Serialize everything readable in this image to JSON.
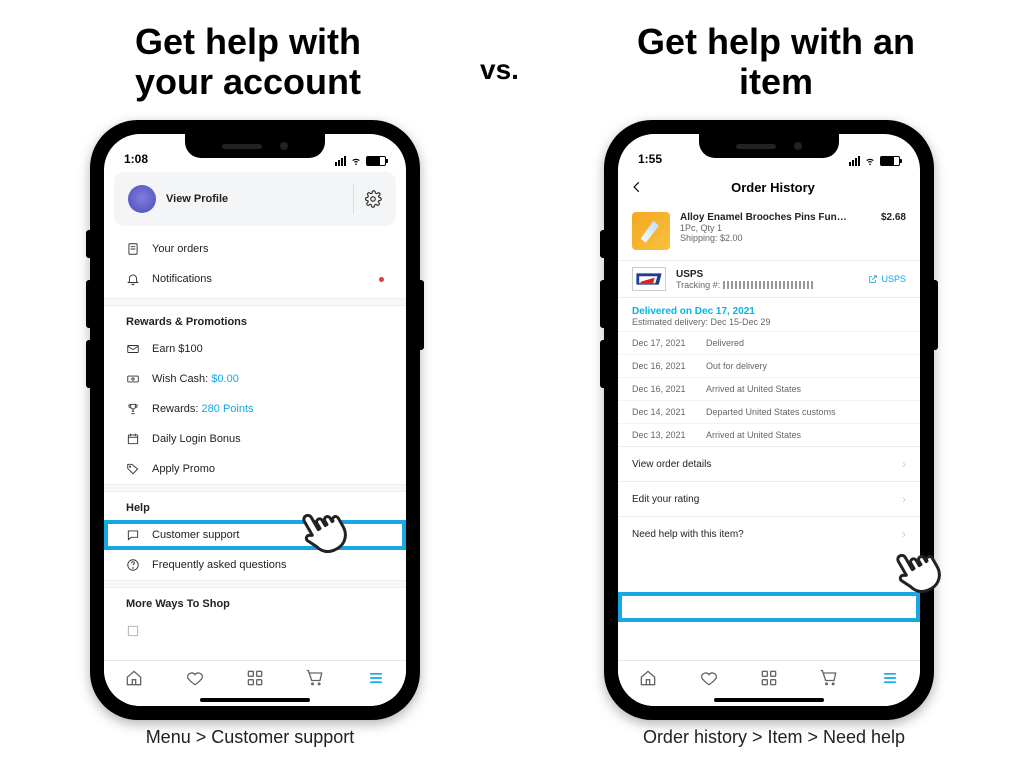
{
  "headings": {
    "left": "Get help with your account",
    "right": "Get help with an item",
    "vs": "vs."
  },
  "captions": {
    "left": "Menu > Customer support",
    "right": "Order history > Item > Need help"
  },
  "phone1": {
    "status_time": "1:08",
    "profile": {
      "view_profile": "View Profile"
    },
    "menu": {
      "your_orders": "Your orders",
      "notifications": "Notifications"
    },
    "rewards_header": "Rewards & Promotions",
    "rewards": {
      "earn": "Earn $100",
      "wish_cash_label": "Wish Cash: ",
      "wish_cash_value": "$0.00",
      "rewards_label": "Rewards: ",
      "rewards_value": "280 Points",
      "daily_login": "Daily Login Bonus",
      "apply_promo": "Apply Promo"
    },
    "help_header": "Help",
    "help": {
      "customer_support": "Customer support",
      "faq": "Frequently asked questions"
    },
    "more_header": "More Ways To Shop"
  },
  "phone2": {
    "status_time": "1:55",
    "nav_title": "Order History",
    "item": {
      "title": "Alloy Enamel Brooches Pins Fun…",
      "price": "$2.68",
      "qty": "1Pc, Qty 1",
      "shipping": "Shipping: $2.00"
    },
    "carrier": {
      "name": "USPS",
      "tracking_label": "Tracking #: ",
      "tracking_link": "USPS"
    },
    "delivery": {
      "title": "Delivered on Dec 17, 2021",
      "estimate": "Estimated delivery: Dec 15-Dec 29"
    },
    "tracking": [
      {
        "date": "Dec 17, 2021",
        "status": "Delivered"
      },
      {
        "date": "Dec 16, 2021",
        "status": "Out for delivery"
      },
      {
        "date": "Dec 16, 2021",
        "status": "Arrived at United States"
      },
      {
        "date": "Dec 14, 2021",
        "status": "Departed United States customs"
      },
      {
        "date": "Dec 13, 2021",
        "status": "Arrived at United States"
      }
    ],
    "actions": {
      "view_details": "View order details",
      "edit_rating": "Edit your rating",
      "need_help": "Need help with this item?"
    }
  }
}
